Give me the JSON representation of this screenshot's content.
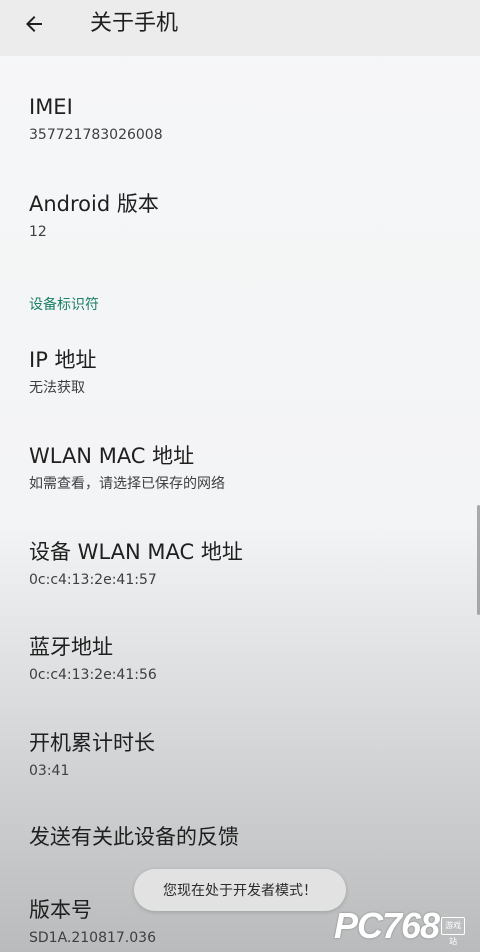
{
  "header": {
    "title": "关于手机",
    "back_icon": "arrow-left-icon"
  },
  "items": [
    {
      "title": "IMEI",
      "subtitle": "357721783026008"
    },
    {
      "title": "Android 版本",
      "subtitle": "12"
    }
  ],
  "section": {
    "header": "设备标识符"
  },
  "items2": [
    {
      "title": "IP 地址",
      "subtitle": "无法获取"
    },
    {
      "title": "WLAN MAC 地址",
      "subtitle": "如需查看，请选择已保存的网络"
    },
    {
      "title": "设备 WLAN MAC 地址",
      "subtitle": "0c:c4:13:2e:41:57"
    },
    {
      "title": "蓝牙地址",
      "subtitle": "0c:c4:13:2e:41:56"
    },
    {
      "title": "开机累计时长",
      "subtitle": "03:41"
    },
    {
      "title": "发送有关此设备的反馈"
    },
    {
      "title": "版本号",
      "subtitle": "SD1A.210817.036"
    }
  ],
  "toast": "您现在处于开发者模式！",
  "watermark": {
    "brand": "PC768",
    "badge": "游戏站"
  },
  "colors": {
    "accent": "#1a7f66",
    "background": "#f6f7f8",
    "topbar": "#ececec"
  }
}
